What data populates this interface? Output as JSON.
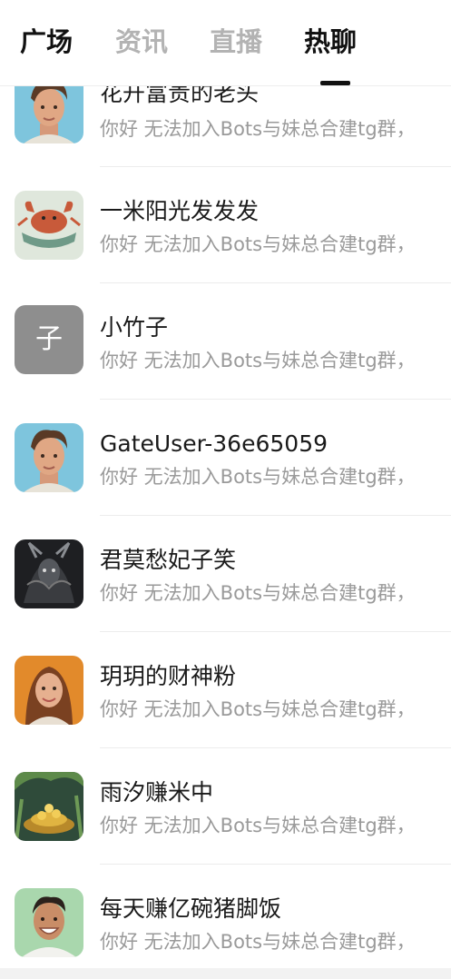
{
  "tabs": [
    {
      "label": "广场"
    },
    {
      "label": "资讯"
    },
    {
      "label": "直播"
    },
    {
      "label": "热聊"
    }
  ],
  "chats": [
    {
      "name": "花开富贵的老头",
      "preview": "你好 无法加入Bots与妹总合建tg群，",
      "avatar_icon": "young-man-portrait"
    },
    {
      "name": "一米阳光发发发",
      "preview": "你好 无法加入Bots与妹总合建tg群，",
      "avatar_icon": "crab-emblem"
    },
    {
      "name": "小竹子",
      "preview": "你好 无法加入Bots与妹总合建tg群，",
      "avatar_letter": "子"
    },
    {
      "name": "GateUser-36e65059",
      "preview": "你好 无法加入Bots与妹总合建tg群，",
      "avatar_icon": "young-man-portrait"
    },
    {
      "name": "君莫愁妃子笑",
      "preview": "你好 无法加入Bots与妹总合建tg群，",
      "avatar_icon": "dark-dragon"
    },
    {
      "name": "玥玥的财神粉",
      "preview": "你好 无法加入Bots与妹总合建tg群，",
      "avatar_icon": "woman-portrait"
    },
    {
      "name": "雨汐赚米中",
      "preview": "你好 无法加入Bots与妹总合建tg群，",
      "avatar_icon": "gold-coins-jungle"
    },
    {
      "name": "每天赚亿碗猪脚饭",
      "preview": "你好 无法加入Bots与妹总合建tg群，",
      "avatar_icon": "smiling-man-portrait"
    }
  ]
}
